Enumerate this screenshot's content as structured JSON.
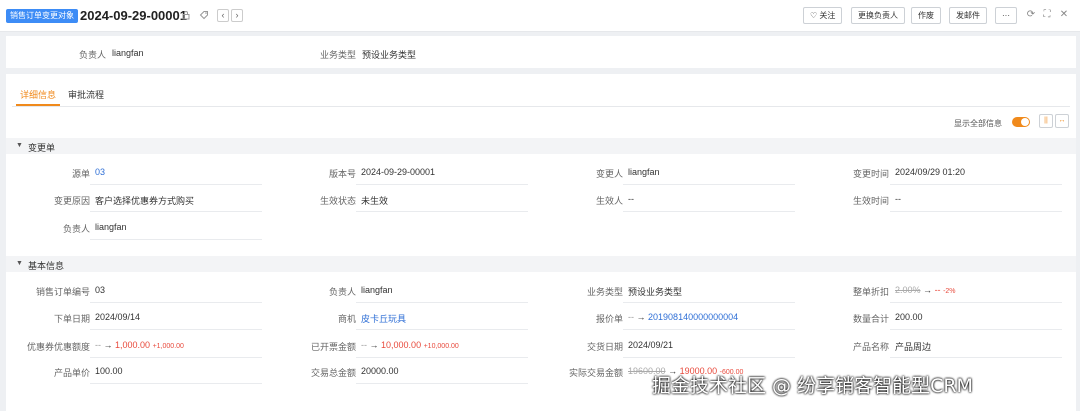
{
  "header": {
    "object_badge": "销售订单变更对象",
    "title": "2024-09-29-00001",
    "actions": [
      "关注",
      "更换负责人",
      "作废",
      "发邮件",
      "···"
    ]
  },
  "summary": {
    "owner_label": "负责人",
    "owner_value": "liangfan",
    "biz_type_label": "业务类型",
    "biz_type_value": "预设业务类型"
  },
  "tabs": [
    {
      "label": "详细信息",
      "active": true
    },
    {
      "label": "审批流程",
      "active": false
    }
  ],
  "toolbar": {
    "show_all_label": "显示全部信息",
    "show_all_on": true
  },
  "sections": {
    "change": {
      "title": "变更单",
      "fields": {
        "source_label": "源单",
        "source_value": "03",
        "version_label": "版本号",
        "version_value": "2024-09-29-00001",
        "changer_label": "变更人",
        "changer_value": "liangfan",
        "change_time_label": "变更时间",
        "change_time_value": "2024/09/29 01:20",
        "reason_label": "变更原因",
        "reason_value": "客户选择优惠券方式购买",
        "effect_status_label": "生效状态",
        "effect_status_value": "未生效",
        "effector_label": "生效人",
        "effector_value": "--",
        "effect_time_label": "生效时间",
        "effect_time_value": "--",
        "owner_label": "负责人",
        "owner_value": "liangfan"
      }
    },
    "basic": {
      "title": "基本信息",
      "fields": {
        "order_no_label": "销售订单编号",
        "order_no_value": "03",
        "owner_label": "负责人",
        "owner_value": "liangfan",
        "biz_type_label": "业务类型",
        "biz_type_value": "预设业务类型",
        "discount_label": "整单折扣",
        "discount_old": "2.00%",
        "discount_arrow": "→",
        "discount_new": "--",
        "discount_delta": "-2%",
        "order_date_label": "下单日期",
        "order_date_value": "2024/09/14",
        "opportunity_label": "商机",
        "opportunity_value": "皮卡丘玩具",
        "quote_label": "报价单",
        "quote_old": "--",
        "quote_arrow": "→",
        "quote_new": "201908140000000004",
        "qty_label": "数量合计",
        "qty_value": "200.00",
        "coupon_label": "优惠券优惠额度",
        "coupon_old": "--",
        "coupon_arrow": "→",
        "coupon_new": "1,000.00",
        "coupon_delta": "+1,000.00",
        "invoiced_label": "已开票金额",
        "invoiced_old": "--",
        "invoiced_arrow": "→",
        "invoiced_new": "10,000.00",
        "invoiced_delta": "+10,000.00",
        "delivery_date_label": "交货日期",
        "delivery_date_value": "2024/09/21",
        "product_name_label": "产品名称",
        "product_name_value": "产品周边",
        "unit_price_label": "产品单价",
        "unit_price_value": "100.00",
        "total_label": "交易总金额",
        "total_value": "20000.00",
        "actual_label": "实际交易金额",
        "actual_old": "19600.00",
        "actual_arrow": "→",
        "actual_new": "19000.00",
        "actual_delta": "-600.00"
      }
    }
  },
  "watermark": "掘金技术社区 @ 纷享销客智能型CRM"
}
